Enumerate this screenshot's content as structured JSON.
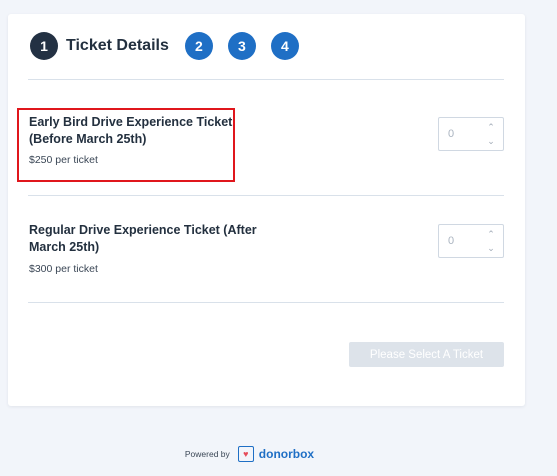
{
  "steps": {
    "current_number": "1",
    "current_title": "Ticket Details",
    "others": [
      "2",
      "3",
      "4"
    ]
  },
  "tickets": [
    {
      "name": "Early Bird Drive Experience Ticket (Before March 25th)",
      "price": "$250 per ticket",
      "quantity": "0"
    },
    {
      "name": "Regular Drive Experience Ticket (After March 25th)",
      "price": "$300 per ticket",
      "quantity": "0"
    }
  ],
  "submit_label": "Please Select A Ticket",
  "footer": {
    "powered_by": "Powered by",
    "brand": "donorbox"
  },
  "colors": {
    "step_active": "#233143",
    "step_inactive": "#1f6fc5",
    "highlight": "#e0161c",
    "brand": "#1f6fc5"
  }
}
